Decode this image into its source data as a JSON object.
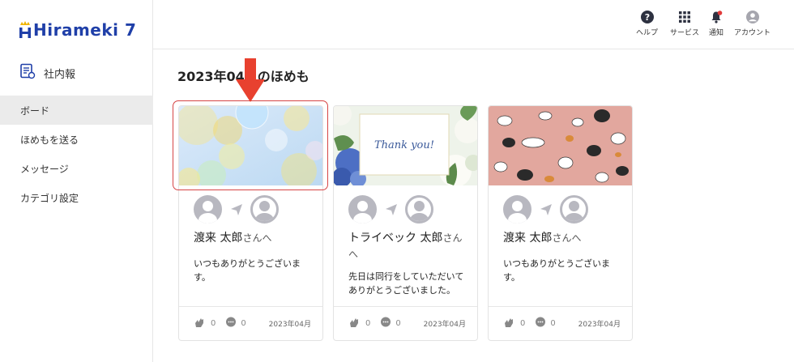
{
  "app": {
    "logo_text": "Hirameki 7"
  },
  "sidebar": {
    "section_label": "社内報",
    "items": [
      {
        "label": "ボード",
        "active": true
      },
      {
        "label": "ほめもを送る",
        "active": false
      },
      {
        "label": "メッセージ",
        "active": false
      },
      {
        "label": "カテゴリ設定",
        "active": false
      }
    ]
  },
  "header": {
    "buttons": [
      {
        "label": "ヘルプ",
        "icon": "help-icon"
      },
      {
        "label": "サービス",
        "icon": "grid-icon"
      },
      {
        "label": "通知",
        "icon": "bell-icon"
      },
      {
        "label": "アカウント",
        "icon": "account-icon"
      }
    ]
  },
  "main": {
    "title": "2023年04月のほめも",
    "cards": [
      {
        "image": "bubbles-image",
        "recipient_name": "渡来 太郎",
        "recipient_suffix": "さんへ",
        "message": "いつもありがとうございます。",
        "claps": "0",
        "comments": "0",
        "date": "2023年04月"
      },
      {
        "image": "thank-you-card-image",
        "image_text": "Thank you!",
        "recipient_name": "トライベック 太郎",
        "recipient_suffix": "さんへ",
        "message": "先日は同行をしていただいてありがとうございました。",
        "claps": "0",
        "comments": "0",
        "date": "2023年04月"
      },
      {
        "image": "cats-pattern-image",
        "recipient_name": "渡来 太郎",
        "recipient_suffix": "さんへ",
        "message": "いつもありがとうございます。",
        "claps": "0",
        "comments": "0",
        "date": "2023年04月"
      }
    ]
  },
  "colors": {
    "brand": "#1f3fa8",
    "highlight": "#d64545",
    "arrow": "#e8412f",
    "active_nav": "#ebebeb",
    "avatar": "#b8b8c0",
    "cats_bg": "#e2a79e"
  }
}
